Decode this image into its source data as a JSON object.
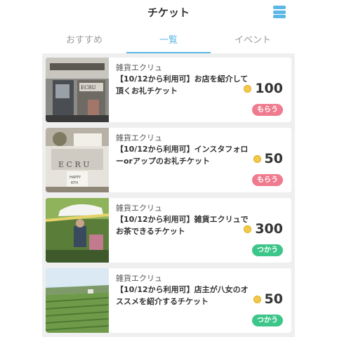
{
  "header": {
    "title": "チケット",
    "menu_icon": "menu-icon"
  },
  "tabs": [
    {
      "label": "おすすめ",
      "active": false
    },
    {
      "label": "一覧",
      "active": true
    },
    {
      "label": "イベント",
      "active": false
    }
  ],
  "tickets": [
    {
      "shop": "雑貨エクリュ",
      "title": "【10/12から利用可】お店を紹介して頂くお礼チケット",
      "points": "100",
      "action": "もらう",
      "action_color": "#f07a8e",
      "image": "shop-storefront-photo"
    },
    {
      "shop": "雑貨エクリュ",
      "title": "【10/12から利用可】インスタフォローorアップのお礼チケット",
      "points": "50",
      "action": "もらう",
      "action_color": "#f07a8e",
      "image": "shop-interior-photo"
    },
    {
      "shop": "雑貨エクリュ",
      "title": "【10/12から利用可】雑貨エクリュでお茶できるチケット",
      "points": "300",
      "action": "つかう",
      "action_color": "#3cc68a",
      "image": "garden-tea-photo"
    },
    {
      "shop": "雑貨エクリュ",
      "title": "【10/12から利用可】店主が八女のオススメを紹介するチケット",
      "points": "50",
      "action": "つかう",
      "action_color": "#3cc68a",
      "image": "tea-field-photo"
    }
  ]
}
